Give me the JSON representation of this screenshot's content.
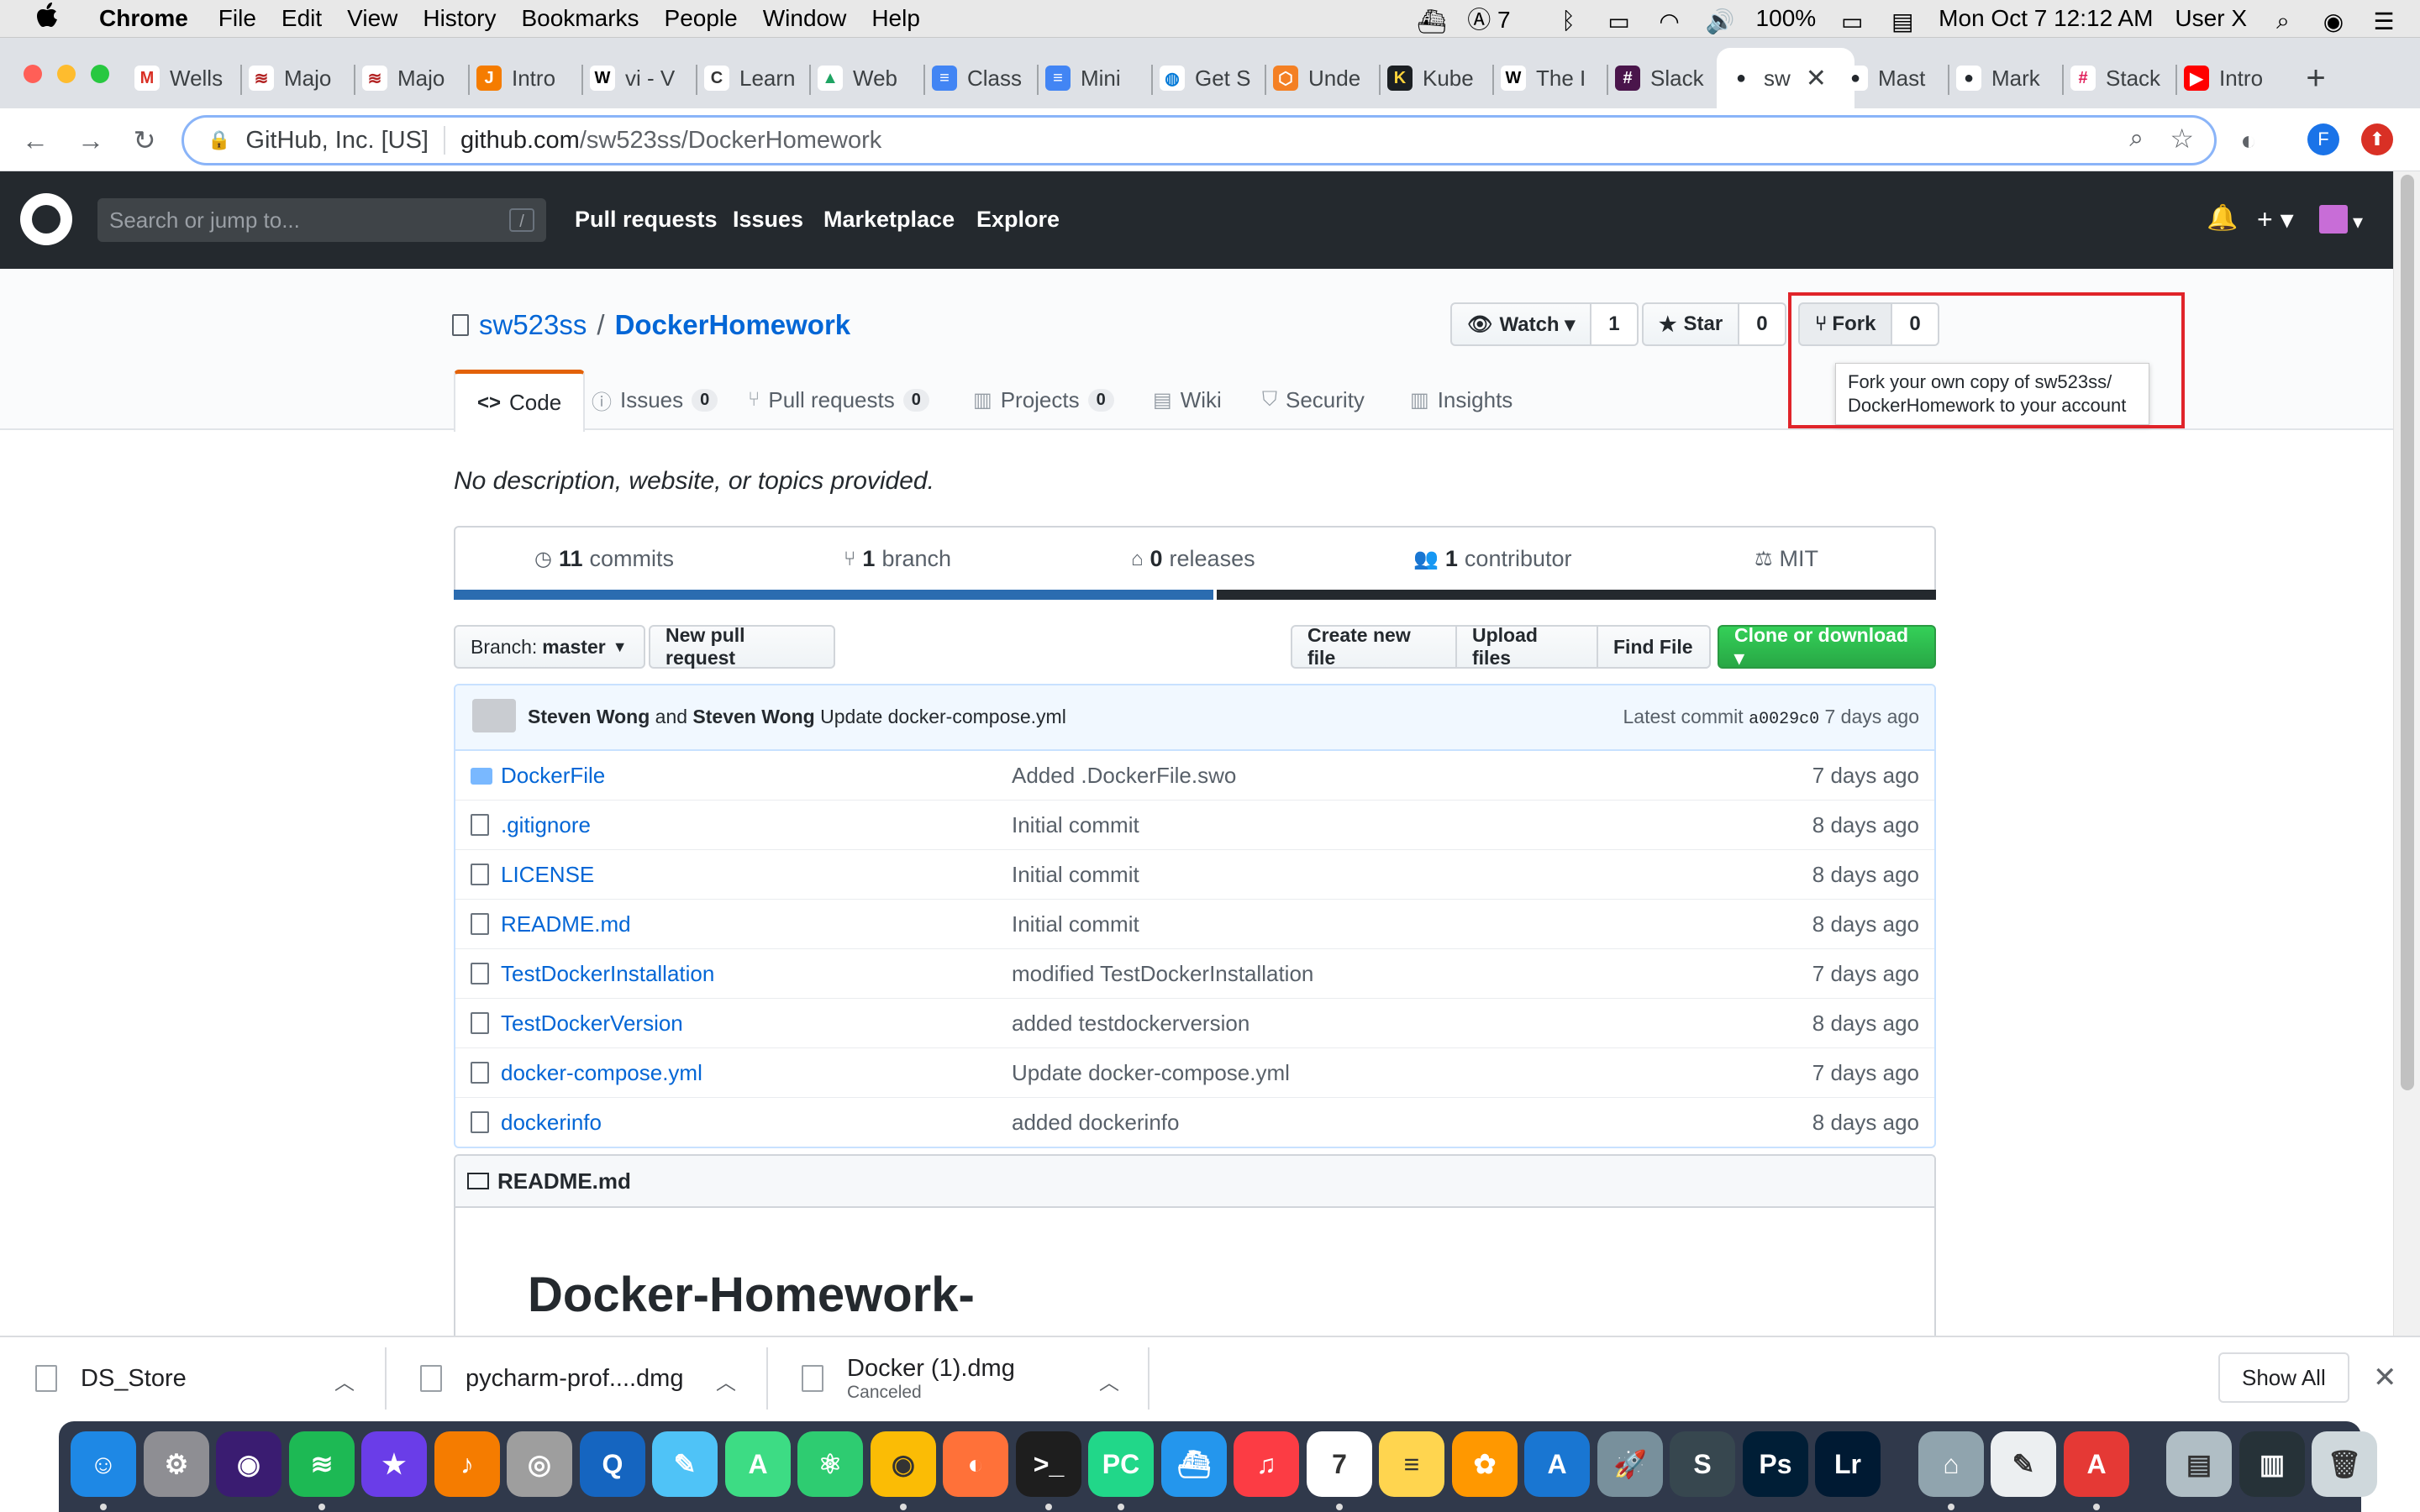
{
  "menubar": {
    "apple": "",
    "app": "Chrome",
    "items": [
      "File",
      "Edit",
      "View",
      "History",
      "Bookmarks",
      "People",
      "Window",
      "Help"
    ],
    "status": {
      "adobe_count": "7",
      "battery": "100%",
      "datetime": "Mon Oct 7  12:12 AM",
      "user": "User X"
    }
  },
  "tabs": [
    {
      "label": "Wells",
      "fav_color": "#ffffff",
      "glyph": "M",
      "glyph_color": "#d93025"
    },
    {
      "label": "Majo",
      "fav_color": "#ffffff",
      "glyph": "≋",
      "glyph_color": "#b22222"
    },
    {
      "label": "Majo",
      "fav_color": "#ffffff",
      "glyph": "≋",
      "glyph_color": "#b22222"
    },
    {
      "label": "Intro",
      "fav_color": "#f57c00",
      "glyph": "J",
      "glyph_color": "#ffffff"
    },
    {
      "label": "vi - V",
      "fav_color": "#ffffff",
      "glyph": "W",
      "glyph_color": "#000000"
    },
    {
      "label": "Learn",
      "fav_color": "#ffffff",
      "glyph": "C",
      "glyph_color": "#333333"
    },
    {
      "label": "Web",
      "fav_color": "#ffffff",
      "glyph": "▲",
      "glyph_color": "#1fa463"
    },
    {
      "label": "Class",
      "fav_color": "#4285f4",
      "glyph": "≡",
      "glyph_color": "#ffffff"
    },
    {
      "label": "Mini",
      "fav_color": "#4285f4",
      "glyph": "≡",
      "glyph_color": "#ffffff"
    },
    {
      "label": "Get S",
      "fav_color": "#ffffff",
      "glyph": "◍",
      "glyph_color": "#0078d7"
    },
    {
      "label": "Unde",
      "fav_color": "#f48024",
      "glyph": "⬡",
      "glyph_color": "#ffffff"
    },
    {
      "label": "Kube",
      "fav_color": "#1b1f23",
      "glyph": "K",
      "glyph_color": "#ffd43b"
    },
    {
      "label": "The I",
      "fav_color": "#ffffff",
      "glyph": "W",
      "glyph_color": "#000000"
    },
    {
      "label": "Slack",
      "fav_color": "#4a154b",
      "glyph": "#",
      "glyph_color": "#ffffff"
    },
    {
      "label": "sw",
      "fav_color": "#ffffff",
      "glyph": "●",
      "glyph_color": "#24292e",
      "active": true
    },
    {
      "label": "Mast",
      "fav_color": "#ffffff",
      "glyph": "●",
      "glyph_color": "#24292e"
    },
    {
      "label": "Mark",
      "fav_color": "#ffffff",
      "glyph": "●",
      "glyph_color": "#24292e"
    },
    {
      "label": "Stack",
      "fav_color": "#ffffff",
      "glyph": "#",
      "glyph_color": "#e01e5a"
    },
    {
      "label": "Intro",
      "fav_color": "#ff0000",
      "glyph": "▶",
      "glyph_color": "#ffffff"
    }
  ],
  "new_tab": "+",
  "tab_close": "✕",
  "toolbar": {
    "org": "GitHub, Inc. [US]",
    "host": "github.com",
    "path": "/sw523ss/DockerHomework",
    "profile_initial": "F"
  },
  "gh": {
    "search_placeholder": "Search or jump to...",
    "slash": "/",
    "nav": [
      "Pull requests",
      "Issues",
      "Marketplace",
      "Explore"
    ],
    "plus": "+ ▾",
    "bell": "🔔",
    "caret": "▾"
  },
  "repo": {
    "owner": "sw523ss",
    "slash": "/",
    "name": "DockerHomework",
    "watch_label": "Watch ▾",
    "watch_count": "1",
    "star_label": "Star",
    "star_count": "0",
    "fork_label": "Fork",
    "fork_count": "0",
    "tooltip_line1": "Fork your own copy of sw523ss/",
    "tooltip_line2": "DockerHomework to your account",
    "tabs": {
      "code": "Code",
      "issues": "Issues",
      "issues_count": "0",
      "pulls": "Pull requests",
      "pulls_count": "0",
      "projects": "Projects",
      "projects_count": "0",
      "wiki": "Wiki",
      "security": "Security",
      "insights": "Insights"
    },
    "description": "No description, website, or topics provided.",
    "summary": {
      "commits_n": "11",
      "commits_l": "commits",
      "branch_n": "1",
      "branch_l": "branch",
      "releases_n": "0",
      "releases_l": "releases",
      "contrib_n": "1",
      "contrib_l": "contributor",
      "license": "MIT"
    },
    "lang_colors": [
      "#2b6cb0",
      "#24292e"
    ],
    "branch_label": "Branch:",
    "branch_name": "master",
    "new_pr": "New pull request",
    "create_file": "Create new file",
    "upload": "Upload files",
    "find": "Find File",
    "clone": "Clone or download ▾",
    "commit": {
      "author1": "Steven Wong",
      "and": "and",
      "author2": "Steven Wong",
      "message": "Update docker-compose.yml",
      "latest": "Latest commit",
      "sha": "a0029c0",
      "age": "7 days ago"
    },
    "files": [
      {
        "name": "DockerFile",
        "type": "dir",
        "msg": "Added .DockerFile.swo",
        "age": "7 days ago"
      },
      {
        "name": ".gitignore",
        "type": "file",
        "msg": "Initial commit",
        "age": "8 days ago"
      },
      {
        "name": "LICENSE",
        "type": "file",
        "msg": "Initial commit",
        "age": "8 days ago"
      },
      {
        "name": "README.md",
        "type": "file",
        "msg": "Initial commit",
        "age": "8 days ago"
      },
      {
        "name": "TestDockerInstallation",
        "type": "file",
        "msg": "modified TestDockerInstallation",
        "age": "7 days ago"
      },
      {
        "name": "TestDockerVersion",
        "type": "file",
        "msg": "added testdockerversion",
        "age": "8 days ago"
      },
      {
        "name": "docker-compose.yml",
        "type": "file",
        "msg": "Update docker-compose.yml",
        "age": "7 days ago"
      },
      {
        "name": "dockerinfo",
        "type": "file",
        "msg": "added dockerinfo",
        "age": "8 days ago"
      }
    ],
    "readme_title": "README.md",
    "readme_h1": "Docker-Homework-"
  },
  "downloads": {
    "items": [
      {
        "name": "DS_Store",
        "sub": ""
      },
      {
        "name": "pycharm-prof....dmg",
        "sub": ""
      },
      {
        "name": "Docker (1).dmg",
        "sub": "Canceled"
      }
    ],
    "show_all": "Show All",
    "close": "✕"
  },
  "dock": [
    {
      "name": "finder",
      "color": "#1e88e5",
      "glyph": "☺"
    },
    {
      "name": "system-preferences",
      "color": "#8e8e93",
      "glyph": "⚙"
    },
    {
      "name": "siri",
      "color": "#3a1c71",
      "glyph": "◉"
    },
    {
      "name": "spotify",
      "color": "#1db954",
      "glyph": "≋"
    },
    {
      "name": "imovie",
      "color": "#6a3de8",
      "glyph": "★"
    },
    {
      "name": "garageband",
      "color": "#f57c00",
      "glyph": "♪"
    },
    {
      "name": "disk-utility",
      "color": "#9e9e9e",
      "glyph": "◎"
    },
    {
      "name": "quicktime",
      "color": "#1565c0",
      "glyph": "Q"
    },
    {
      "name": "preview",
      "color": "#4fc3f7",
      "glyph": "✎"
    },
    {
      "name": "android-studio",
      "color": "#3ddc84",
      "glyph": "A"
    },
    {
      "name": "atom",
      "color": "#2ecc71",
      "glyph": "⚛"
    },
    {
      "name": "chrome",
      "color": "#fbbc05",
      "glyph": "◉"
    },
    {
      "name": "firefox",
      "color": "#ff7139",
      "glyph": "◐"
    },
    {
      "name": "terminal",
      "color": "#1e1e1e",
      "glyph": ">_"
    },
    {
      "name": "pycharm",
      "color": "#21d789",
      "glyph": "PC"
    },
    {
      "name": "docker",
      "color": "#2496ed",
      "glyph": "⛴"
    },
    {
      "name": "itunes",
      "color": "#fc3c44",
      "glyph": "♫"
    },
    {
      "name": "calendar",
      "color": "#ffffff",
      "glyph": "7"
    },
    {
      "name": "notes",
      "color": "#ffd54f",
      "glyph": "≡"
    },
    {
      "name": "photos",
      "color": "#ff9800",
      "glyph": "✿"
    },
    {
      "name": "app-store",
      "color": "#1976d2",
      "glyph": "A"
    },
    {
      "name": "launchpad",
      "color": "#78909c",
      "glyph": "🚀"
    },
    {
      "name": "sublime",
      "color": "#37474f",
      "glyph": "S"
    },
    {
      "name": "photoshop",
      "color": "#001e36",
      "glyph": "Ps"
    },
    {
      "name": "lightroom",
      "color": "#001a33",
      "glyph": "Lr"
    },
    {
      "name": "system-utility",
      "color": "#90a4ae",
      "glyph": "⌂"
    },
    {
      "name": "textedit",
      "color": "#eceff1",
      "glyph": "✎"
    },
    {
      "name": "acrobat",
      "color": "#e53935",
      "glyph": "A"
    },
    {
      "name": "downloads-stack",
      "color": "#b0bec5",
      "glyph": "▤"
    },
    {
      "name": "documents-stack",
      "color": "#263238",
      "glyph": "▥"
    },
    {
      "name": "trash",
      "color": "#cfd8dc",
      "glyph": "🗑"
    }
  ],
  "colors": {
    "link": "#0366d6",
    "gh_header": "#24292e",
    "green_button": "#28a745",
    "highlight_box": "#e0242a",
    "active_tab_underline": "#e36209"
  }
}
